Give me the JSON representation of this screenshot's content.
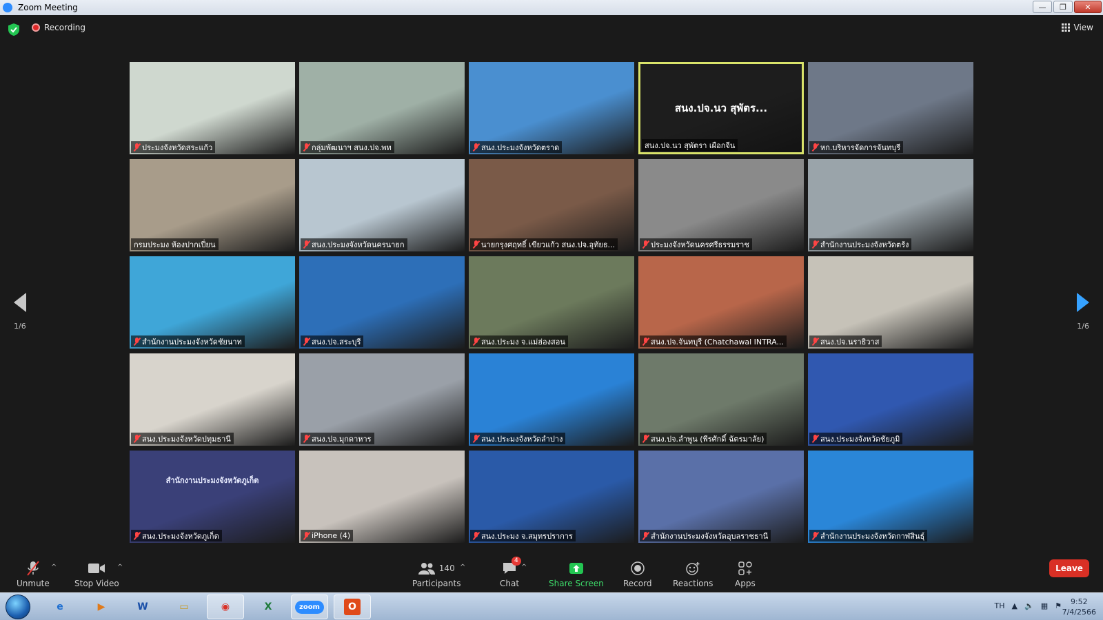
{
  "window": {
    "title": "Zoom Meeting",
    "btn_min": "—",
    "btn_max": "❐",
    "btn_close": "✕"
  },
  "meeting_bar": {
    "recording_label": "Recording",
    "view_label": "View"
  },
  "gallery": {
    "page_left": "1/6",
    "page_right": "1/6",
    "tiles": [
      {
        "name": "ประมงจังหวัดสระแก้ว",
        "muted": true,
        "bg": "#cfd8cf"
      },
      {
        "name": "กลุ่มพัฒนาฯ สนง.ปจ.พท",
        "muted": true,
        "bg": "#9fb0a6"
      },
      {
        "name": "สนง.ประมงจังหวัดตราด",
        "muted": true,
        "bg": "#4a8fd0"
      },
      {
        "name": "สนง.ปจ.นว สุพัตรา เผือกจีน",
        "muted": false,
        "bg": "#1d1d1d",
        "center_text": "สนง.ปจ.นว สุพัตร..."
      },
      {
        "name": "หก.บริหารจัดการจันทบุรี",
        "muted": true,
        "bg": "#6e7888"
      },
      {
        "name": "กรมประมง ห้องปากเปี่ยน",
        "muted": false,
        "bg": "#a89c8a"
      },
      {
        "name": "สนง.ประมงจังหวัดนครนายก",
        "muted": true,
        "bg": "#b8c6d0"
      },
      {
        "name": "นายกรุงศฤทธิ์ เขียวแก้ว สนง.ปจ.อุทัยธ...",
        "muted": true,
        "bg": "#7a5a48"
      },
      {
        "name": "ประมงจังหวัดนครศรีธรรมราช",
        "muted": true,
        "bg": "#8a8a8a"
      },
      {
        "name": "สำนักงานประมงจังหวัดตรัง",
        "muted": true,
        "bg": "#9aa4aa"
      },
      {
        "name": "สำนักงานประมงจังหวัดชัยนาท",
        "muted": true,
        "bg": "#3fa6d8"
      },
      {
        "name": "สนง.ปจ.สระบุรี",
        "muted": true,
        "bg": "#2d6fb8"
      },
      {
        "name": "สนง.ประมง จ.แม่ฮ่องสอน",
        "muted": true,
        "bg": "#6c7a5c"
      },
      {
        "name": "สนง.ปจ.จันทบุรี (Chatchawal INTRA...",
        "muted": true,
        "bg": "#b8664a"
      },
      {
        "name": "สนง.ปจ.นราธิวาส",
        "muted": true,
        "bg": "#c6c2b8"
      },
      {
        "name": "สนง.ประมงจังหวัดปทุมธานี",
        "muted": true,
        "bg": "#d8d4cc"
      },
      {
        "name": "สนง.ปจ.มุกดาหาร",
        "muted": true,
        "bg": "#9aa0a8"
      },
      {
        "name": "สนง.ประมงจังหวัดลำปาง",
        "muted": true,
        "bg": "#2a82d6"
      },
      {
        "name": "สนง.ปจ.ลำพูน (พีรศักดิ์ ฉัตรมาลัย)",
        "muted": true,
        "bg": "#6e7a6a"
      },
      {
        "name": "สนง.ประมงจังหวัดชัยภูมิ",
        "muted": true,
        "bg": "#3058b0"
      },
      {
        "name": "สนง.ประมงจังหวัดภูเก็ต",
        "muted": true,
        "bg": "#3a4078",
        "center_text": "สำนักงานประมงจังหวัดภูเก็ต"
      },
      {
        "name": "iPhone (4)",
        "muted": true,
        "bg": "#c8c2bc"
      },
      {
        "name": "สนง.ประมง จ.สมุทรปราการ",
        "muted": true,
        "bg": "#2a5aa8"
      },
      {
        "name": "สำนักงานประมงจังหวัดอุบลราชธานี",
        "muted": true,
        "bg": "#5a70a8"
      },
      {
        "name": "สำนักงานประมงจังหวัดกาฬสินธุ์",
        "muted": true,
        "bg": "#2a86d8"
      }
    ]
  },
  "toolbar": {
    "unmute": "Unmute",
    "stop_video": "Stop Video",
    "participants": "Participants",
    "participants_count": "140",
    "chat": "Chat",
    "chat_badge": "4",
    "share_screen": "Share Screen",
    "record": "Record",
    "reactions": "Reactions",
    "apps": "Apps",
    "leave": "Leave",
    "share_color": "#0e71eb"
  },
  "taskbar": {
    "apps": [
      {
        "icon": "internet-explorer-icon",
        "label": "e"
      },
      {
        "icon": "media-player-icon",
        "label": "▶"
      },
      {
        "icon": "word-icon",
        "label": "W"
      },
      {
        "icon": "file-explorer-icon",
        "label": "▭"
      },
      {
        "icon": "chrome-icon",
        "label": "◉"
      },
      {
        "icon": "excel-icon",
        "label": "X"
      },
      {
        "icon": "zoom-icon",
        "label": "zoom"
      },
      {
        "icon": "office-icon",
        "label": "O"
      }
    ],
    "lang": "TH",
    "time": "9:52",
    "date": "7/4/2566"
  }
}
